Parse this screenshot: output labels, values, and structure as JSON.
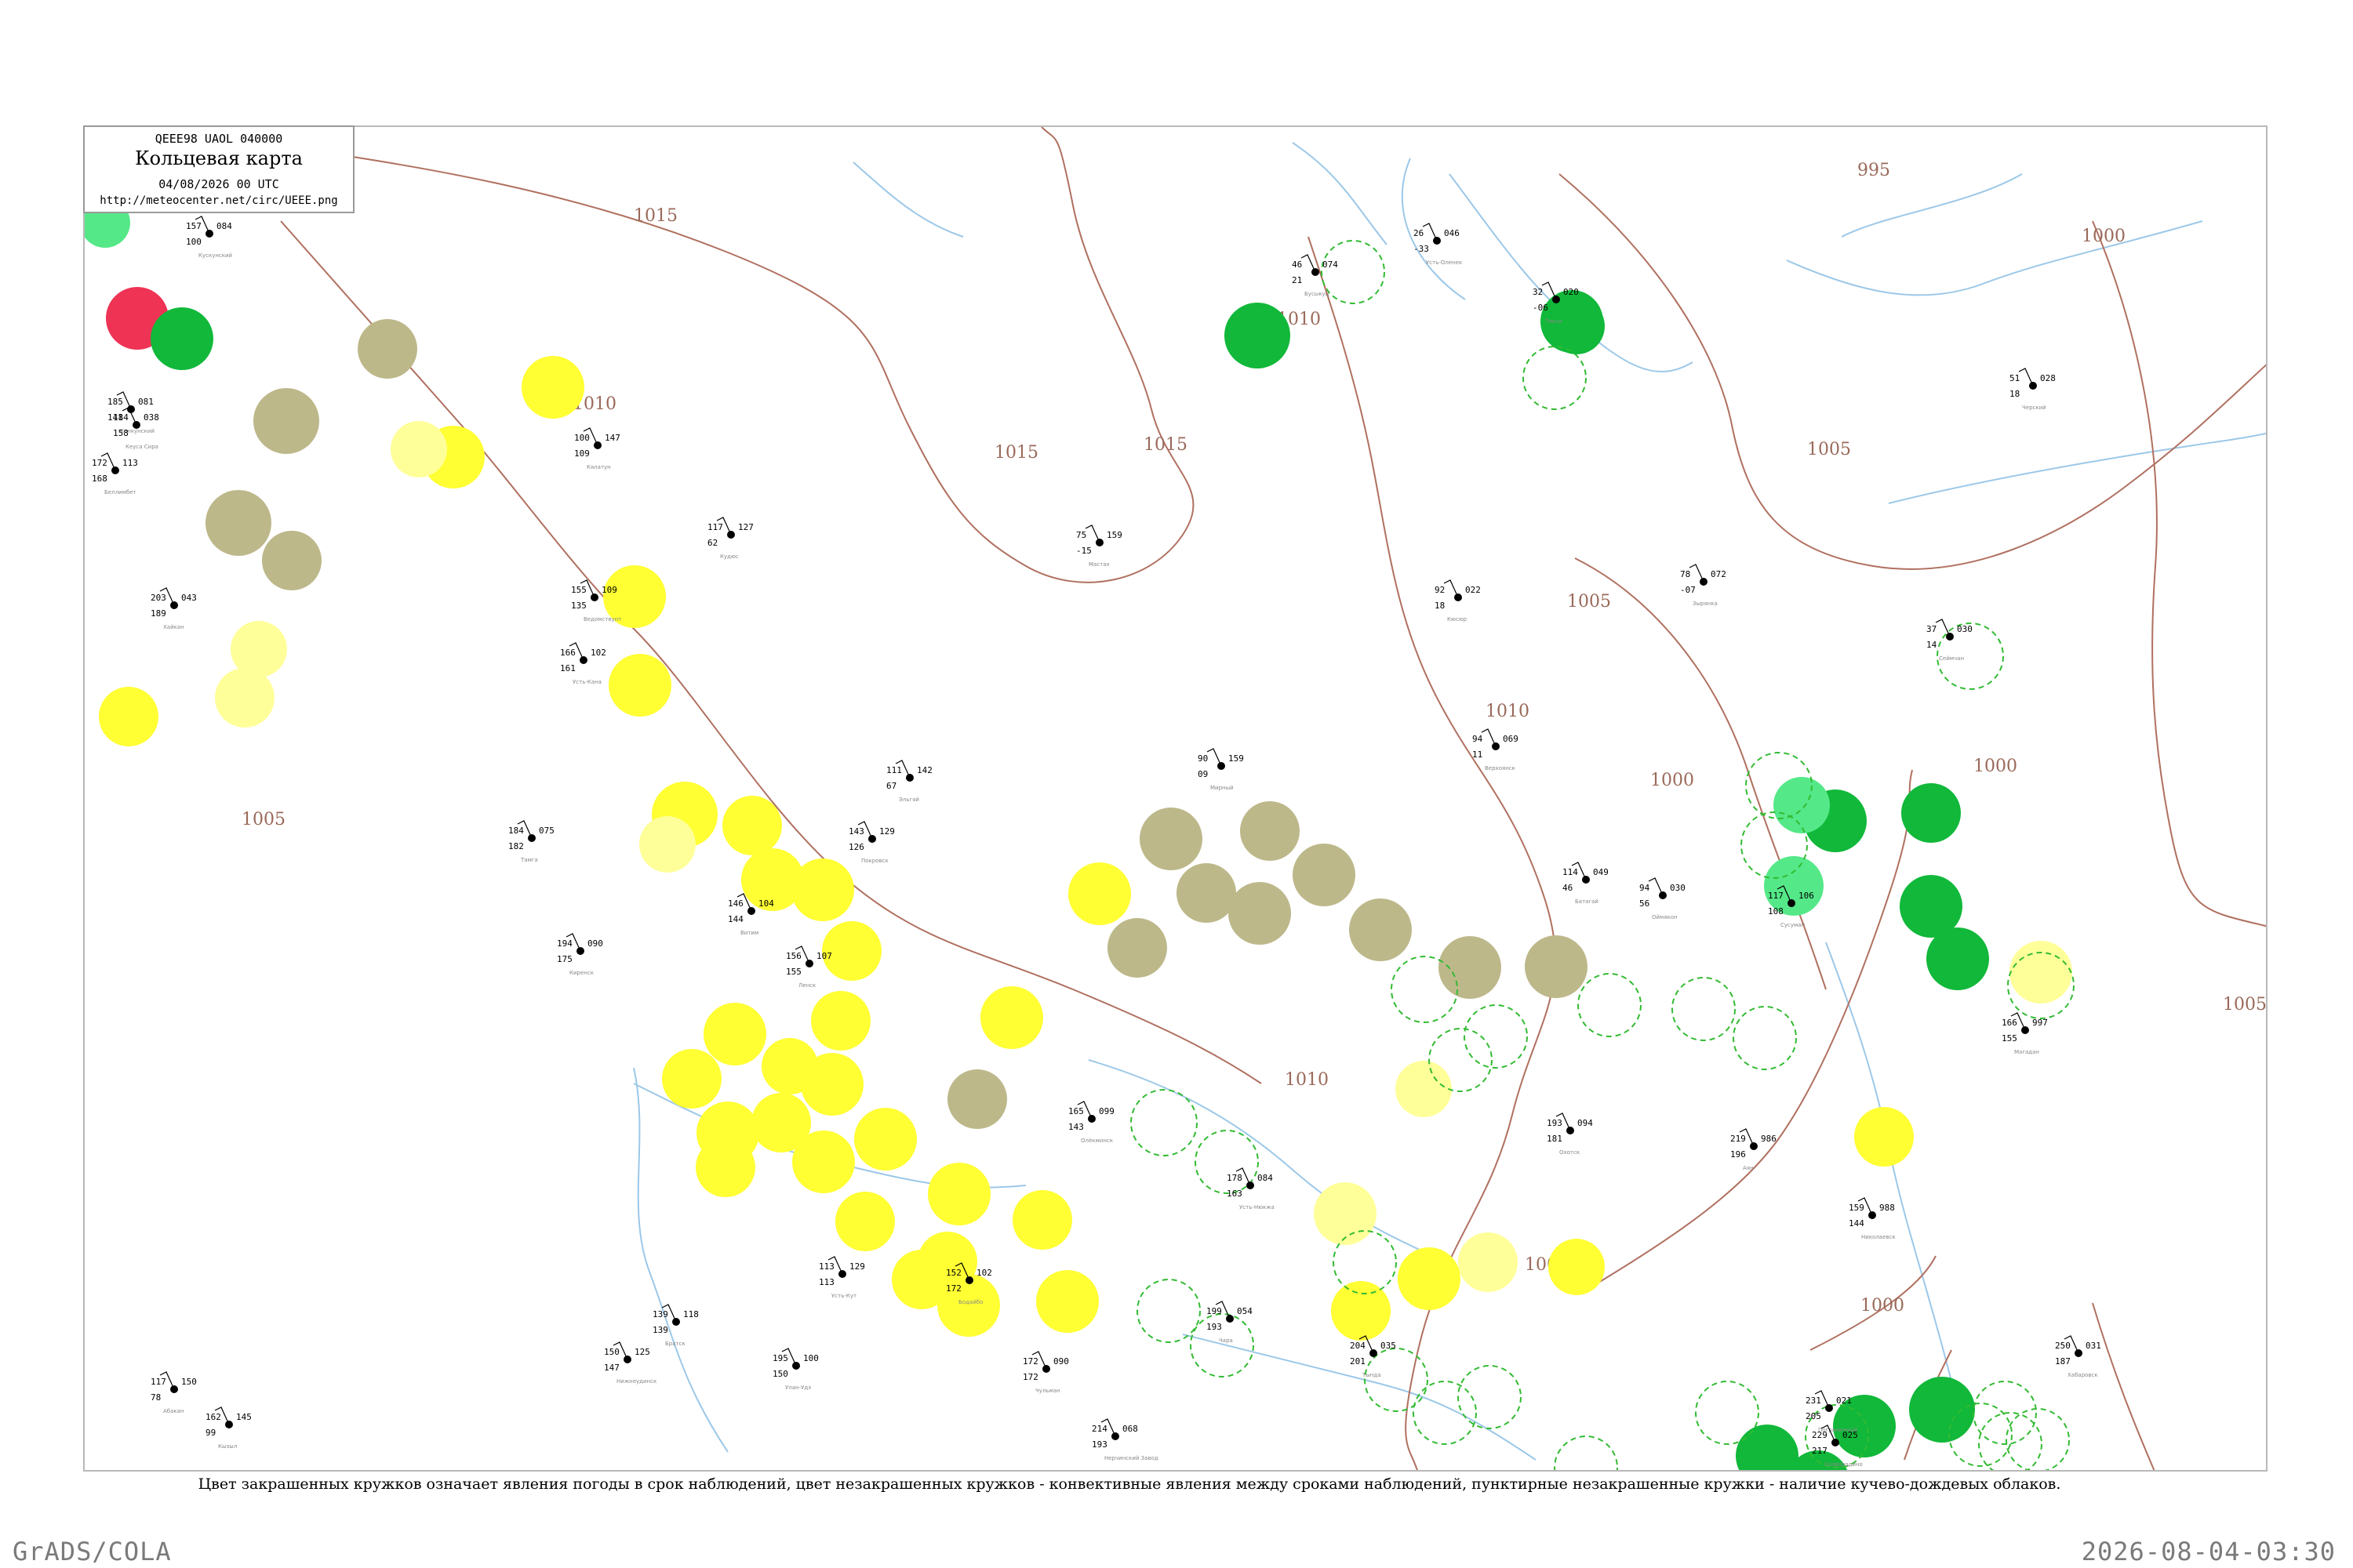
{
  "header": {
    "codes": "QEEE98  UAOL  040000",
    "title": "Кольцевая карта",
    "datetime": "04/08/2026 00 UTC",
    "url": "http://meteocenter.net/circ/UEEE.png"
  },
  "caption": "Цвет закрашенных кружков означает явления погоды в срок наблюдений, цвет незакрашенных кружков - конвективные явления между сроками наблюдений, пунктирные незакрашенные кружки - наличие кучево-дождевых облаков.",
  "footer": {
    "left": "GrADS/COLA",
    "right": "2026-08-04-03:30"
  },
  "colors": {
    "isobar": "#b07060",
    "river": "#9cc8e8",
    "yellow": "#ffff33",
    "light_yellow": "#ffff99",
    "olive": "#bdb88a",
    "green": "#11b83a",
    "light_green": "#55e888",
    "red": "#ee3355",
    "dashed_ring": "#33bb33",
    "frame": "#b8b8b8"
  },
  "isobar_labels": [
    "1015",
    "1015",
    "1015",
    "1010",
    "1010",
    "1010",
    "1010",
    "1005",
    "1005",
    "1005",
    "1005",
    "1000",
    "1000",
    "1000",
    "1000",
    "1000",
    "995"
  ],
  "circle_legend": {
    "filled": "явления погоды в срок наблюдений",
    "open": "конвективные явления между сроками наблюдений",
    "dashed": "наличие кучево-дождевых облаков"
  },
  "stations": [
    {
      "t": "185",
      "td": "141",
      "p": "081",
      "name": "Канкунский"
    },
    {
      "t": "184",
      "td": "158",
      "p": "038",
      "name": "Кеуса Сира"
    },
    {
      "t": "172",
      "td": "168",
      "p": "113",
      "name": "Беллимбет"
    },
    {
      "t": "203",
      "td": "189",
      "p": "043",
      "name": "Хайкан"
    },
    {
      "t": "157",
      "td": "100",
      "p": "084",
      "name": "Кускунский"
    },
    {
      "t": "100",
      "td": "109",
      "p": "147",
      "name": "Кялатун"
    },
    {
      "t": "155",
      "td": "135",
      "p": "109",
      "name": "Ведомствунт"
    },
    {
      "t": "166",
      "td": "161",
      "p": "102",
      "name": "Усть-Кана"
    },
    {
      "t": "117",
      "td": "62",
      "p": "127",
      "name": "Кудюс"
    },
    {
      "t": "75",
      "td": "-15",
      "p": "159",
      "name": "Мастах"
    },
    {
      "t": "46",
      "td": "21",
      "p": "074",
      "name": "Бусыкуц"
    },
    {
      "t": "26",
      "td": "-33",
      "p": "046",
      "name": "Усть-Оленек"
    },
    {
      "t": "32",
      "td": "-06",
      "p": "020",
      "name": "Тикси"
    },
    {
      "t": "51",
      "td": "18",
      "p": "028",
      "name": "Черский"
    },
    {
      "t": "90",
      "td": "09",
      "p": "159",
      "name": "Мирный"
    },
    {
      "t": "94",
      "td": "11",
      "p": "069",
      "name": "Верхоянск"
    },
    {
      "t": "78",
      "td": "-07",
      "p": "072",
      "name": "Зырянка"
    },
    {
      "t": "92",
      "td": "18",
      "p": "022",
      "name": "Кюсюр"
    },
    {
      "t": "37",
      "td": "14",
      "p": "030",
      "name": "Сеймчан"
    },
    {
      "t": "111",
      "td": "67",
      "p": "142",
      "name": "Эльгяй"
    },
    {
      "t": "114",
      "td": "46",
      "p": "049",
      "name": "Батагай"
    },
    {
      "t": "94",
      "td": "56",
      "p": "030",
      "name": "Оймякон"
    },
    {
      "t": "117",
      "td": "108",
      "p": "106",
      "name": "Сусуман"
    },
    {
      "t": "143",
      "td": "126",
      "p": "129",
      "name": "Покровск"
    },
    {
      "t": "184",
      "td": "182",
      "p": "075",
      "name": "Тамга"
    },
    {
      "t": "194",
      "td": "175",
      "p": "090",
      "name": "Киренск"
    },
    {
      "t": "146",
      "td": "144",
      "p": "104",
      "name": "Витим"
    },
    {
      "t": "156",
      "td": "155",
      "p": "107",
      "name": "Ленск"
    },
    {
      "t": "165",
      "td": "143",
      "p": "099",
      "name": "Олёкминск"
    },
    {
      "t": "193",
      "td": "181",
      "p": "094",
      "name": "Охотск"
    },
    {
      "t": "219",
      "td": "196",
      "p": "986",
      "name": "Аян"
    },
    {
      "t": "159",
      "td": "144",
      "p": "988",
      "name": "Николаевск"
    },
    {
      "t": "166",
      "td": "155",
      "p": "997",
      "name": "Магадан"
    },
    {
      "t": "250",
      "td": "187",
      "p": "031",
      "name": "Хабаровск"
    },
    {
      "t": "231",
      "td": "205",
      "p": "021",
      "name": "Пограничный"
    },
    {
      "t": "229",
      "td": "217",
      "p": "025",
      "name": "Сковородино"
    },
    {
      "t": "204",
      "td": "201",
      "p": "035",
      "name": "Тында"
    },
    {
      "t": "199",
      "td": "193",
      "p": "054",
      "name": "Чара"
    },
    {
      "t": "178",
      "td": "163",
      "p": "084",
      "name": "Усть-Нюкжа"
    },
    {
      "t": "214",
      "td": "193",
      "p": "068",
      "name": "Нерчинский Завод"
    },
    {
      "t": "195",
      "td": "150",
      "p": "100",
      "name": "Улан-Удэ"
    },
    {
      "t": "162",
      "td": "99",
      "p": "145",
      "name": "Кызыл"
    },
    {
      "t": "117",
      "td": "78",
      "p": "150",
      "name": "Абакан"
    },
    {
      "t": "150",
      "td": "147",
      "p": "125",
      "name": "Нижнеудинск"
    },
    {
      "t": "139",
      "td": "139",
      "p": "118",
      "name": "Братск"
    },
    {
      "t": "113",
      "td": "113",
      "p": "129",
      "name": "Усть-Кут"
    },
    {
      "t": "152",
      "td": "172",
      "p": "102",
      "name": "Бодайбо"
    },
    {
      "t": "172",
      "td": "172",
      "p": "090",
      "name": "Чульман"
    }
  ]
}
